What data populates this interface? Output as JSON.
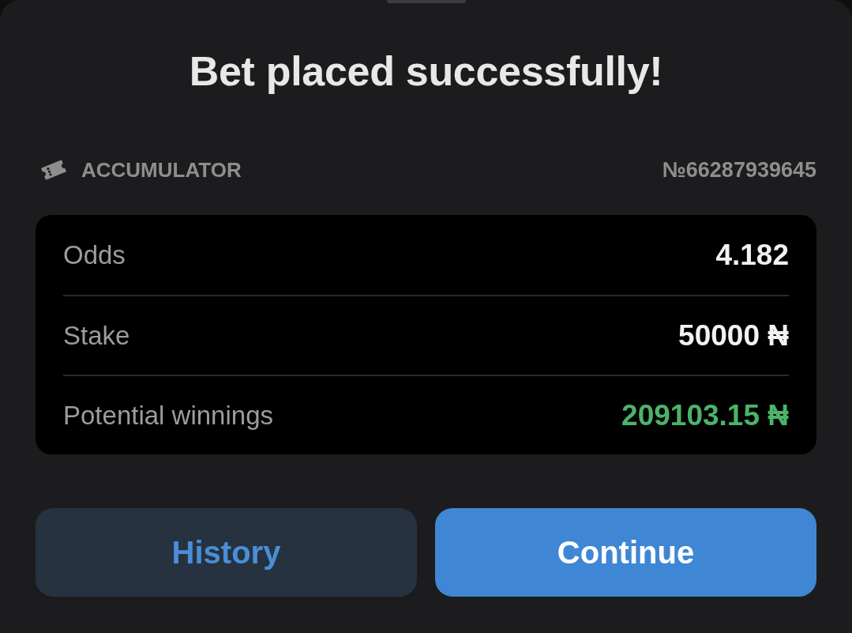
{
  "title": "Bet placed successfully!",
  "bet": {
    "type": "ACCUMULATOR",
    "number": "№66287939645"
  },
  "summary": [
    {
      "label": "Odds",
      "value": "4.182",
      "color": "#f2f2f2"
    },
    {
      "label": "Stake",
      "value": "50000 ₦",
      "color": "#f2f2f2"
    },
    {
      "label": "Potential winnings",
      "value": "209103.15 ₦",
      "color": "#4cb36a"
    }
  ],
  "buttons": [
    {
      "label": "History",
      "kind": "secondary"
    },
    {
      "label": "Continue",
      "kind": "primary"
    }
  ]
}
